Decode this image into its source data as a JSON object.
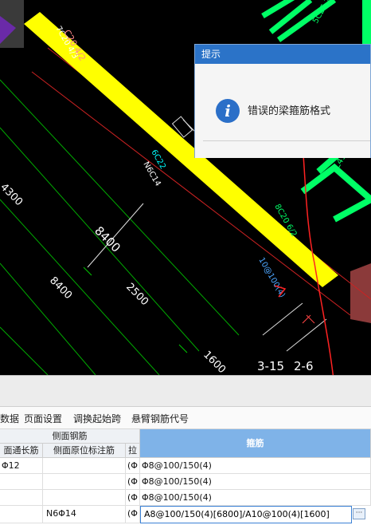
{
  "cad": {
    "beam_labels": [
      "7C20 4/3",
      "C20 4/2",
      "6C22",
      "N6C14",
      "10@100(4)",
      "8C20 6/2",
      "L45(1)",
      "5C25 2/3"
    ],
    "dimensions": [
      "4300",
      "8400",
      "8400",
      "2500",
      "1600"
    ],
    "axis_labels": [
      "3-15",
      "2-6"
    ],
    "colors": {
      "beam_fill": "#ffff00",
      "grid_line": "#00cc00",
      "wall": "#00ff66",
      "selection": "#ff3333"
    }
  },
  "dialog": {
    "title": "提示",
    "icon": "info-icon",
    "message": "错误的梁箍筋格式"
  },
  "toolbar": {
    "items": [
      "数据",
      "页面设置",
      "调换起始跨",
      "悬臂钢筋代号"
    ]
  },
  "grid": {
    "group_header": "侧面钢筋",
    "columns": [
      "面通长筋",
      "侧面原位标注筋",
      "拉",
      "箍筋"
    ],
    "rows": [
      {
        "c1": "Φ12",
        "c2": "",
        "c3": "(Φ",
        "c4": "Φ8@100/150(4)"
      },
      {
        "c1": "",
        "c2": "",
        "c3": "(Φ",
        "c4": "Φ8@100/150(4)"
      },
      {
        "c1": "",
        "c2": "",
        "c3": "(Φ",
        "c4": "Φ8@100/150(4)"
      },
      {
        "c1": "",
        "c2": "N6Φ14",
        "c3": "(Φ",
        "c4": "A8@100/150(4)[6800]/A10@100(4)[1600]"
      }
    ],
    "edit_button": "···"
  }
}
